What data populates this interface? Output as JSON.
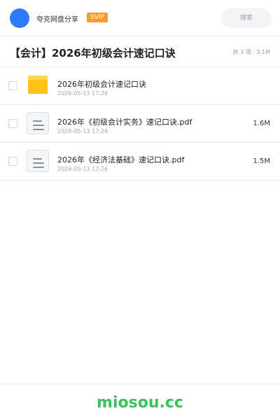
{
  "header": {
    "app_name": "夸克网盘分享",
    "badge": "SVIP",
    "search_label": "搜索"
  },
  "title_row": {
    "title": "【会计】2026年初级会计速记口诀",
    "summary": "共 3 项 · 3.1M"
  },
  "files": [
    {
      "type": "folder",
      "name": "2026年初级会计速记口诀",
      "date": "2026-05-13 17:26",
      "size": ""
    },
    {
      "type": "document",
      "name": "2026年《初级会计实务》速记口诀.pdf",
      "date": "2026-05-13 17:26",
      "size": "1.6M"
    },
    {
      "type": "document",
      "name": "2026年《经济法基础》速记口诀.pdf",
      "date": "2026-05-13 17:26",
      "size": "1.5M"
    }
  ],
  "footer": {
    "watermark": "miosou.cc"
  },
  "colors": {
    "avatar": "#2f7bff",
    "badge": "#ff9a2a",
    "folder": "#ffc21a",
    "watermark": "#3cc15a"
  }
}
